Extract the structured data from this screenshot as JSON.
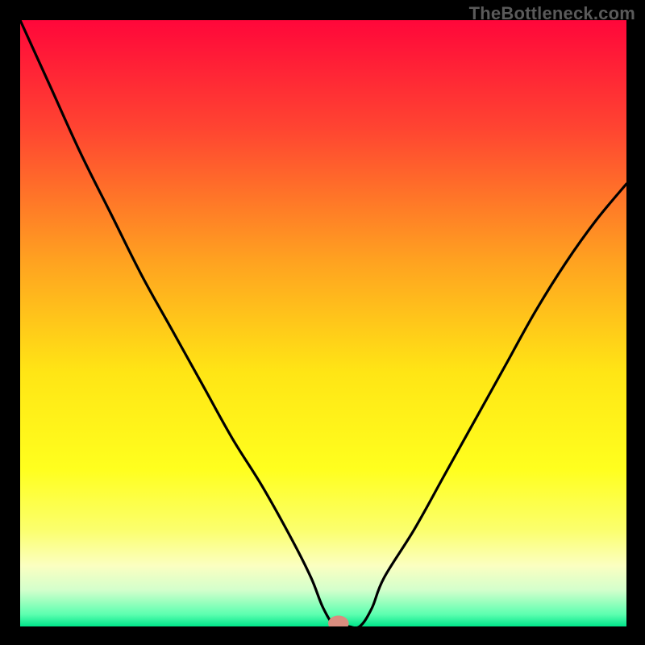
{
  "watermark": "TheBottleneck.com",
  "chart_data": {
    "type": "line",
    "title": "",
    "xlabel": "",
    "ylabel": "",
    "xlim": [
      0,
      100
    ],
    "ylim": [
      0,
      100
    ],
    "grid": false,
    "legend": false,
    "series": [
      {
        "name": "curve",
        "x": [
          0,
          5,
          10,
          15,
          20,
          25,
          30,
          35,
          40,
          45,
          48,
          50,
          52,
          54,
          56,
          58,
          60,
          65,
          70,
          75,
          80,
          85,
          90,
          95,
          100
        ],
        "y": [
          100,
          89,
          78,
          68,
          58,
          49,
          40,
          31,
          23,
          14,
          8,
          3,
          0,
          0,
          0,
          3,
          8,
          16,
          25,
          34,
          43,
          52,
          60,
          67,
          73
        ]
      }
    ],
    "background_gradient": {
      "stops": [
        {
          "offset": 0.0,
          "color": "#ff073a"
        },
        {
          "offset": 0.18,
          "color": "#ff4531"
        },
        {
          "offset": 0.4,
          "color": "#ffa320"
        },
        {
          "offset": 0.58,
          "color": "#ffe515"
        },
        {
          "offset": 0.74,
          "color": "#ffff1e"
        },
        {
          "offset": 0.84,
          "color": "#fbff6c"
        },
        {
          "offset": 0.9,
          "color": "#fbffc1"
        },
        {
          "offset": 0.94,
          "color": "#d3ffcc"
        },
        {
          "offset": 0.98,
          "color": "#5dffb0"
        },
        {
          "offset": 1.0,
          "color": "#00e58a"
        }
      ]
    },
    "marker": {
      "x": 52.5,
      "y": 0.5,
      "rx": 1.7,
      "ry": 1.3,
      "color": "#d98d7f"
    }
  }
}
